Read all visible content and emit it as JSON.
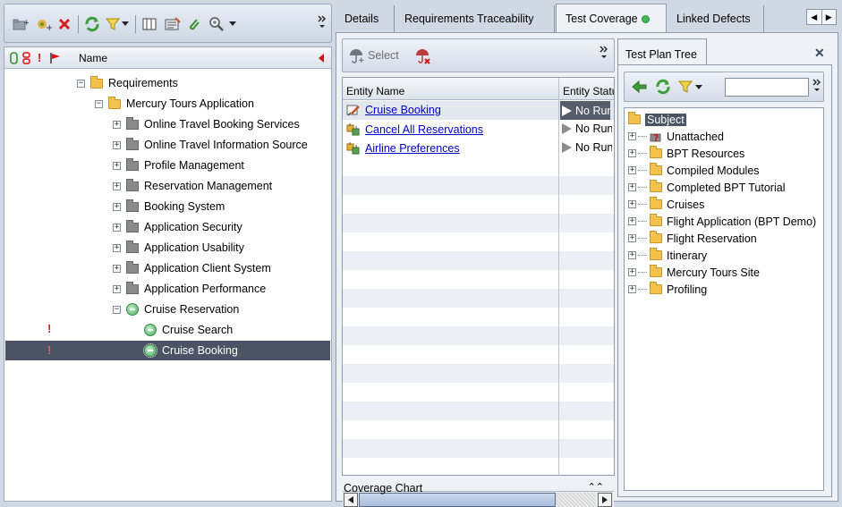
{
  "left_tree": {
    "header": {
      "name_label": "Name"
    },
    "rows": [
      {
        "label": "Requirements"
      },
      {
        "label": "Mercury Tours Application"
      },
      {
        "label": "Online Travel Booking Services"
      },
      {
        "label": "Online Travel Information Source"
      },
      {
        "label": "Profile Management"
      },
      {
        "label": "Reservation Management"
      },
      {
        "label": "Booking System"
      },
      {
        "label": "Application Security"
      },
      {
        "label": "Application Usability"
      },
      {
        "label": "Application Client System"
      },
      {
        "label": "Application Performance"
      },
      {
        "label": "Cruise Reservation"
      },
      {
        "label": "Cruise Search",
        "flag": "!"
      },
      {
        "label": "Cruise Booking",
        "flag": "!",
        "selected": true
      }
    ]
  },
  "tabs": [
    {
      "label": "Details"
    },
    {
      "label": "Requirements Traceability"
    },
    {
      "label": "Test Coverage",
      "active": true
    },
    {
      "label": "Linked Defects"
    }
  ],
  "entity_toolbar": {
    "select_label": "Select"
  },
  "entity_grid": {
    "columns": [
      "Entity Name",
      "Entity Status"
    ],
    "rows": [
      {
        "name": "Cruise Booking",
        "status": "No Run"
      },
      {
        "name": "Cancel All Reservations",
        "status": "No Run"
      },
      {
        "name": "Airline Preferences",
        "status": "No Run"
      }
    ]
  },
  "coverage_chart": {
    "label": "Coverage Chart"
  },
  "test_plan": {
    "tab_label": "Test Plan Tree",
    "search_value": "",
    "root_label": "Subject",
    "items": [
      {
        "label": "Unattached",
        "icon": "unattached-icon"
      },
      {
        "label": "BPT Resources"
      },
      {
        "label": "Compiled Modules"
      },
      {
        "label": "Completed BPT Tutorial"
      },
      {
        "label": "Cruises"
      },
      {
        "label": "Flight Application (BPT Demo)"
      },
      {
        "label": "Flight Reservation"
      },
      {
        "label": "Itinerary"
      },
      {
        "label": "Mercury Tours Site"
      },
      {
        "label": "Profiling"
      }
    ]
  }
}
